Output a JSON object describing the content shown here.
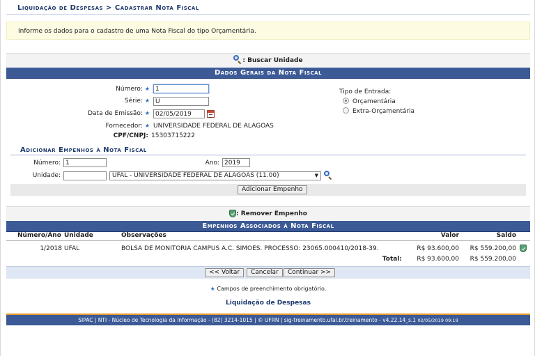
{
  "header": {
    "title": "Liquidação de Despesas > Cadastrar Nota Fiscal"
  },
  "info": {
    "message": "Informe os dados para o cadastro de uma Nota Fiscal do tipo Orçamentária."
  },
  "search_unit": {
    "label": ": Buscar Unidade"
  },
  "dados_gerais": {
    "title": "Dados Gerais da Nota Fiscal",
    "numero_label": "Número:",
    "numero_value": "1",
    "serie_label": "Série:",
    "serie_value": "U",
    "data_label": "Data de Emissão:",
    "data_value": "02/05/2019",
    "fornecedor_label": "Fornecedor:",
    "fornecedor_value": "UNIVERSIDADE FEDERAL DE ALAGOAS",
    "cpf_label": "CPF/CNPJ:",
    "cpf_value": "15303715222",
    "tipo_label": "Tipo de Entrada:",
    "tipo_opcao1": "Orçamentária",
    "tipo_opcao2": "Extra-Orçamentária",
    "required_mark": "★"
  },
  "empenhos": {
    "title": "Adicionar Empenhos à Nota Fiscal",
    "numero_label": "Número:",
    "numero_value": "1",
    "ano_label": "Ano:",
    "ano_value": "2019",
    "unidade_label": "Unidade:",
    "unidade_code": "",
    "unidade_selected": "UFAL - UNIVERSIDADE FEDERAL DE ALAGOAS (11.00)",
    "add_button": "Adicionar Empenho"
  },
  "remove": {
    "label": ": Remover Empenho"
  },
  "associados": {
    "title": "Empenhos Associados à Nota Fiscal",
    "headers": {
      "numero": "Número/Ano",
      "unidade": "Unidade",
      "obs": "Observações",
      "valor": "Valor",
      "saldo": "Saldo"
    },
    "rows": [
      {
        "numero": "1/2018",
        "unidade": "UFAL",
        "obs": "BOLSA DE MONITORIA CAMPUS A.C. SIMOES. PROCESSO: 23065.000410/2018-39.",
        "valor": "R$ 93.600,00",
        "saldo": "R$ 559.200,00"
      }
    ],
    "total_label": "Total:",
    "total_valor": "R$ 93.600,00",
    "total_saldo": "R$ 559.200,00"
  },
  "nav": {
    "voltar": "<< Voltar",
    "cancelar": "Cancelar",
    "continuar": "Continuar >>"
  },
  "footnote": {
    "star": "★",
    "text": " Campos de preenchimento obrigatório."
  },
  "bottom_link": "Liquidação de Despesas",
  "footer": {
    "text": "SIPAC | NTI - Núcleo de Tecnologia da Informação - (82) 3214-1015 | © UFRN | sig-treinamento.ufal.br.treinamento - v4.22.14_s.1",
    "timestamp": "02/05/2019 09:19"
  },
  "colors": {
    "band": "#3c5a96",
    "header_text": "#1e3a6e",
    "info_bg": "#fdfce2",
    "required": "#2b6cc6",
    "footer_accent": "#e99a2a"
  }
}
